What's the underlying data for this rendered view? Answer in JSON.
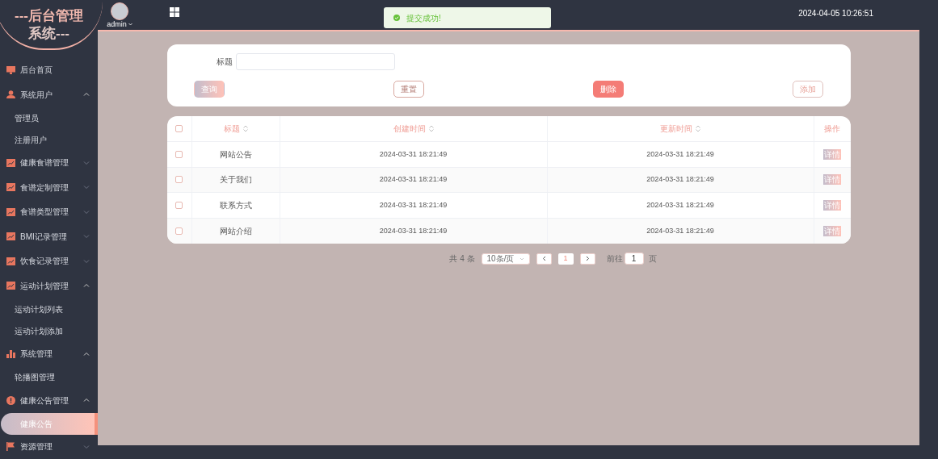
{
  "logo": {
    "line1": "---后台管理",
    "line2": "系统---"
  },
  "header": {
    "user": "admin",
    "datetime": "2024-04-05 10:26:51"
  },
  "toast": {
    "message": "提交成功!"
  },
  "sidebar": {
    "items": [
      {
        "kind": "link",
        "label": "后台首页",
        "selected": false
      },
      {
        "kind": "group",
        "label": "系统用户",
        "expanded": true,
        "children": [
          {
            "label": "管理员",
            "selected": false
          },
          {
            "label": "注册用户",
            "selected": false
          }
        ]
      },
      {
        "kind": "group",
        "label": "健康食谱管理",
        "expanded": false
      },
      {
        "kind": "group",
        "label": "食谱定制管理",
        "expanded": false
      },
      {
        "kind": "group",
        "label": "食谱类型管理",
        "expanded": false
      },
      {
        "kind": "group",
        "label": "BMI记录管理",
        "expanded": false
      },
      {
        "kind": "group",
        "label": "饮食记录管理",
        "expanded": false
      },
      {
        "kind": "group",
        "label": "运动计划管理",
        "expanded": true,
        "children": [
          {
            "label": "运动计划列表",
            "selected": false
          },
          {
            "label": "运动计划添加",
            "selected": false
          }
        ]
      },
      {
        "kind": "group",
        "label": "系统管理",
        "expanded": true,
        "children": [
          {
            "label": "轮播图管理",
            "selected": false
          }
        ]
      },
      {
        "kind": "group",
        "label": "健康公告管理",
        "expanded": true,
        "children": [
          {
            "label": "健康公告",
            "selected": true
          }
        ]
      },
      {
        "kind": "group",
        "label": "资源管理",
        "expanded": false
      }
    ]
  },
  "search": {
    "label": "标题",
    "buttons": [
      {
        "kind": "query",
        "label": "查询"
      },
      {
        "kind": "reset",
        "label": "重置"
      },
      {
        "kind": "delete",
        "label": "删除"
      },
      {
        "kind": "add",
        "label": "添加"
      }
    ]
  },
  "table": {
    "all_checked": false,
    "columns": [
      {
        "label": "标题",
        "sortable": true
      },
      {
        "label": "创建时间",
        "sortable": true
      },
      {
        "label": "更新时间",
        "sortable": true
      },
      {
        "label": "操作",
        "sortable": false
      }
    ],
    "rows": [
      {
        "checked": false,
        "title": "网站公告",
        "created": "2024-03-31 18:21:49",
        "updated": "2024-03-31 18:21:49",
        "action": "详情"
      },
      {
        "checked": false,
        "title": "关于我们",
        "created": "2024-03-31 18:21:49",
        "updated": "2024-03-31 18:21:49",
        "action": "详情"
      },
      {
        "checked": false,
        "title": "联系方式",
        "created": "2024-03-31 18:21:49",
        "updated": "2024-03-31 18:21:49",
        "action": "详情"
      },
      {
        "checked": false,
        "title": "网站介绍",
        "created": "2024-03-31 18:21:49",
        "updated": "2024-03-31 18:21:49",
        "action": "详情"
      }
    ]
  },
  "pagination": {
    "total": "共 4 条",
    "page_size": "10条/页",
    "pages": [
      {
        "label": "1",
        "selected": true
      }
    ],
    "goto_label": "前往",
    "goto_value": "1",
    "goto_suffix": "页"
  }
}
